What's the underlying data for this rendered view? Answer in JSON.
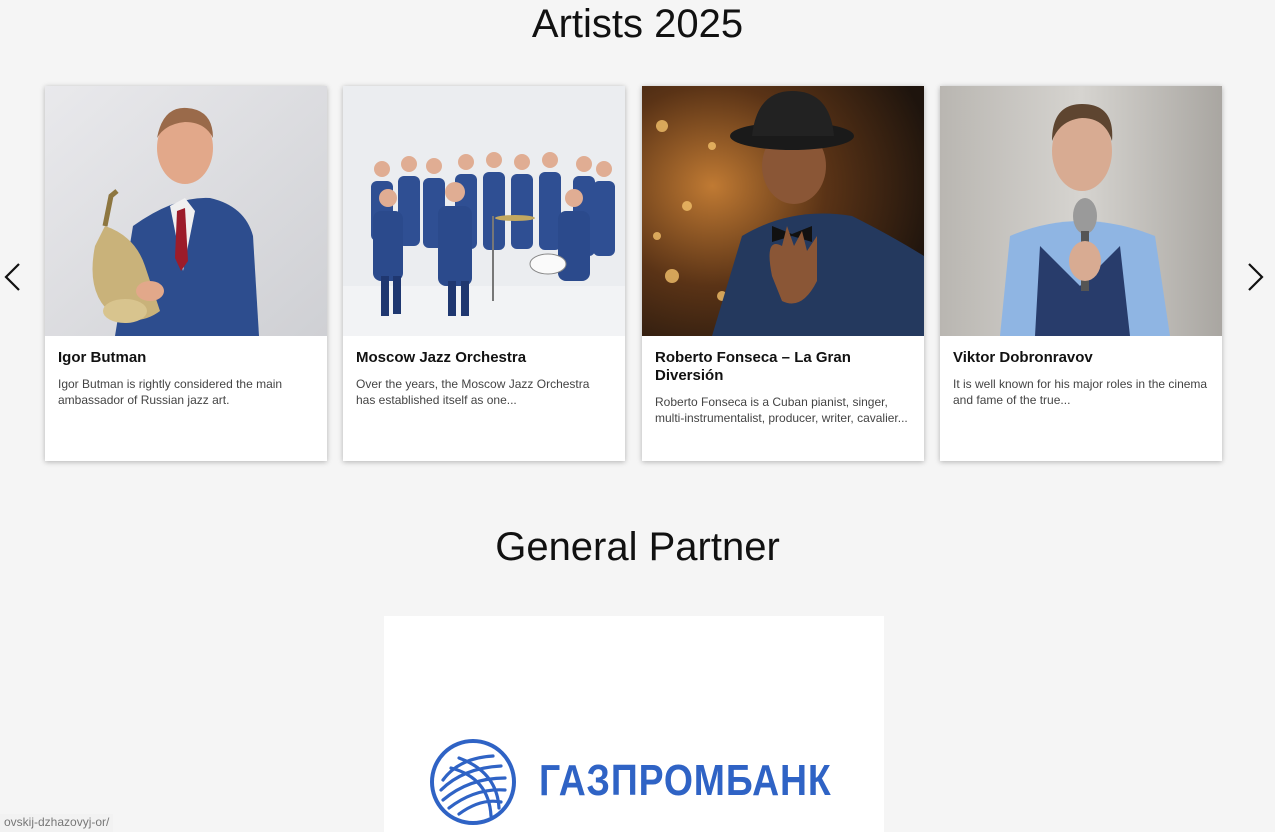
{
  "artists_section": {
    "title": "Artists 2025",
    "prev_icon": "chevron-left-icon",
    "next_icon": "chevron-right-icon",
    "cards": [
      {
        "name": "Igor Butman",
        "description": "Igor Butman is rightly considered the main ambassador of Russian jazz art."
      },
      {
        "name": "Moscow Jazz Orchestra",
        "description": "Over the years, the Moscow Jazz Orchestra has established itself as one..."
      },
      {
        "name": "Roberto Fonseca – La Gran Diversión",
        "description": "Roberto Fonseca is a Cuban pianist, singer, multi-instrumentalist, producer, writer, cavalier..."
      },
      {
        "name": "Viktor Dobronravov",
        "description": "It is well known for his major roles in the cinema and fame of the true..."
      }
    ]
  },
  "partner_section": {
    "title": "General Partner",
    "partner_name": "ГАЗПРОМБАНК",
    "brand_color": "#2f63c5"
  },
  "status_bar": {
    "url": "ovskij-dzhazovyj-or/"
  }
}
